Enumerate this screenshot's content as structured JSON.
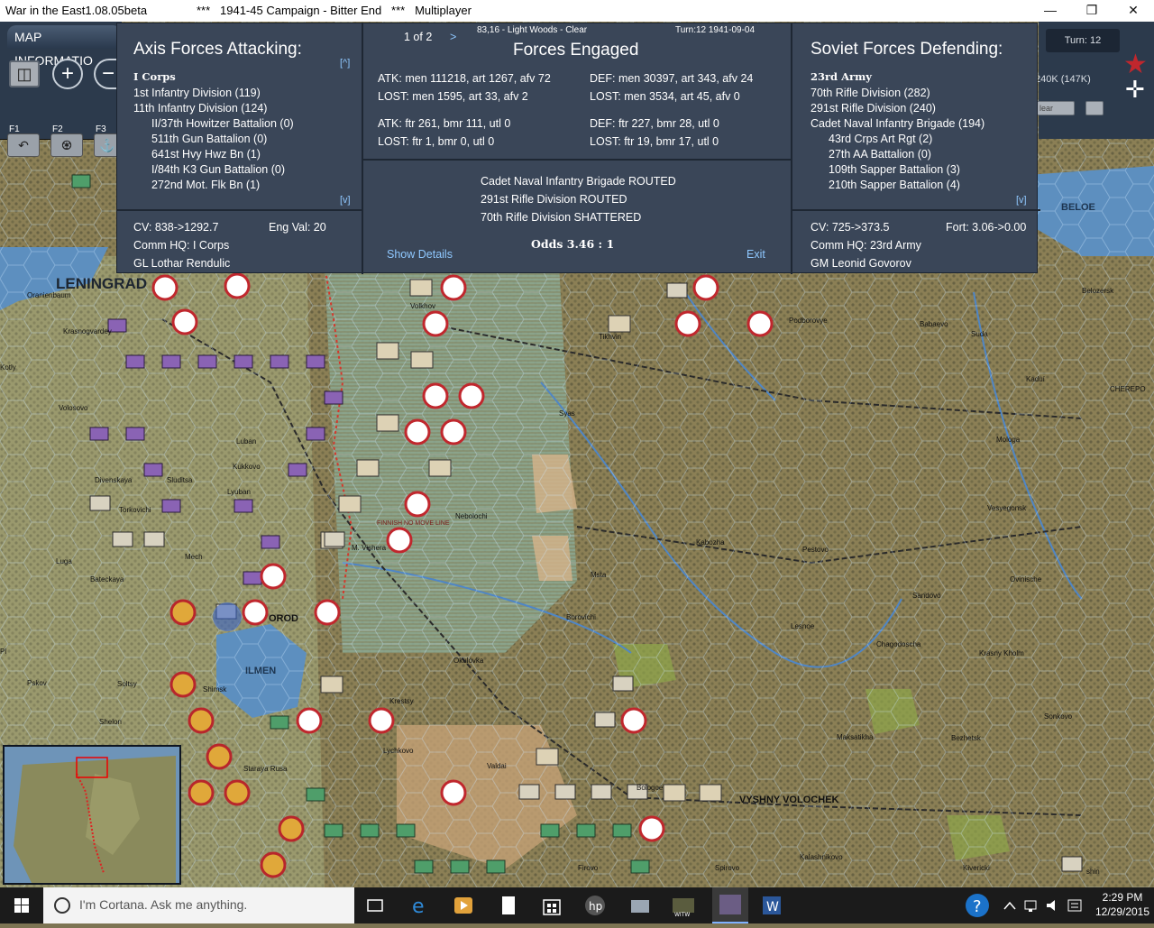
{
  "titlebar": {
    "app": "War in the East1.08.05beta",
    "scenario": "***   1941-45 Campaign - Bitter End   ***   Multiplayer"
  },
  "toolbar": {
    "tab_label": "MAP INFORMATIO",
    "fkeys": [
      "F1",
      "F2",
      "F3"
    ]
  },
  "topright": {
    "turn": "Turn: 12",
    "manpower": "240K (147K)",
    "clear": "lear"
  },
  "battle": {
    "hex_info": "83,16 - Light Woods - Clear",
    "turn_info": "Turn:12  1941-09-04",
    "page": "1 of 2",
    "next": ">",
    "center_title": "Forces Engaged",
    "axis": {
      "title": "Axis Forces Attacking:",
      "formation": "I Corps",
      "units": [
        {
          "name": "1st Infantry Division (119)",
          "indent": 0
        },
        {
          "name": "11th Infantry Division (124)",
          "indent": 0
        },
        {
          "name": "II/37th Howitzer Battalion (0)",
          "indent": 1
        },
        {
          "name": "511th Gun Battalion (0)",
          "indent": 1
        },
        {
          "name": "641st Hvy Hwz Bn (1)",
          "indent": 1
        },
        {
          "name": "I/84th K3 Gun Battalion (0)",
          "indent": 1
        },
        {
          "name": "272nd Mot. Flk Bn (1)",
          "indent": 1
        }
      ],
      "cv": "CV: 838->1292.7",
      "eng_val": "Eng Val: 20",
      "comm_hq": "Comm HQ: I Corps",
      "leader": "GL Lothar Rendulic"
    },
    "soviet": {
      "title": "Soviet Forces Defending:",
      "formation": "23rd Army",
      "units": [
        {
          "name": "70th Rifle Division (282)",
          "indent": 0
        },
        {
          "name": "291st Rifle Division (240)",
          "indent": 0
        },
        {
          "name": "Cadet Naval Infantry Brigade (194)",
          "indent": 0
        },
        {
          "name": "43rd Crps Art Rgt (2)",
          "indent": 1
        },
        {
          "name": "27th AA Battalion (0)",
          "indent": 1
        },
        {
          "name": "109th Sapper Battalion (3)",
          "indent": 1
        },
        {
          "name": "210th Sapper Battalion (4)",
          "indent": 1
        }
      ],
      "cv": "CV: 725->373.5",
      "fort": "Fort: 3.06->0.00",
      "comm_hq": "Comm HQ: 23rd Army",
      "leader": "GM Leonid Govorov"
    },
    "stats": {
      "atk_ground": "ATK: men 111218, art 1267, afv 72",
      "lost_ground_axis": "LOST: men 1595, art 33, afv 2",
      "def_ground": "DEF: men 30397, art 343, afv 24",
      "lost_ground_soviet": "LOST: men 3534, art 45, afv 0",
      "atk_air": "ATK: ftr 261, bmr 111, utl 0",
      "lost_air_axis": "LOST: ftr 1, bmr 0, utl 0",
      "def_air": "DEF: ftr 227, bmr 28, utl 0",
      "lost_air_soviet": "LOST: ftr 19, bmr 17, utl 0"
    },
    "results": [
      "Cadet Naval Infantry Brigade ROUTED",
      "291st Rifle Division ROUTED",
      "70th Rifle Division SHATTERED"
    ],
    "odds": "Odds 3.46 : 1",
    "show_details": "Show Details",
    "exit": "Exit",
    "up_caret": "[^]",
    "down_caret": "[v]"
  },
  "map_labels": {
    "leningrad": "LENINGRAD",
    "novgorod": "OROD",
    "ilmen": "ILMEN",
    "beloe": "BELOE",
    "vyshny": "VYSHNY VOLOCHEK",
    "finnish": "FINNISH NO MOVE LINE",
    "small": [
      "Oranienbaum",
      "Krasnogvardey",
      "Kotly",
      "Volosovo",
      "Luban",
      "Kukkovo",
      "Lyuban",
      "Divenskaya",
      "Sluditsa",
      "Torkovichi",
      "Luga",
      "Bateckaya",
      "Nebolochi",
      "M. Vishera",
      "Borovichi",
      "Okulovka",
      "Shimsk",
      "Soltsy",
      "Shelon",
      "Krestsy",
      "Lychkovo",
      "Staraya Rusa",
      "Valdai",
      "Bologoe",
      "Firovo",
      "Spirovo",
      "Kalashnikovo",
      "Kivericki",
      "Lesnoe",
      "Sandovo",
      "Pestovo",
      "Kabozha",
      "Krasny Kholm",
      "Chagodoscha",
      "Vesyegonsk",
      "Ovinische",
      "Sonkovo",
      "Bezhetsk",
      "Maksatikha",
      "Podborovye",
      "Babaevo",
      "Kaduí",
      "Belozersk",
      "CHEREPO",
      "Tikhvin",
      "Volkhov",
      "Syas",
      "Mologa",
      "Msta",
      "Suda",
      "Mech",
      "Pskov",
      "Pl",
      "shin"
    ]
  },
  "taskbar": {
    "search_placeholder": "I'm Cortana. Ask me anything.",
    "time": "2:29 PM",
    "date": "12/29/2015",
    "witw_label": "WITW"
  }
}
